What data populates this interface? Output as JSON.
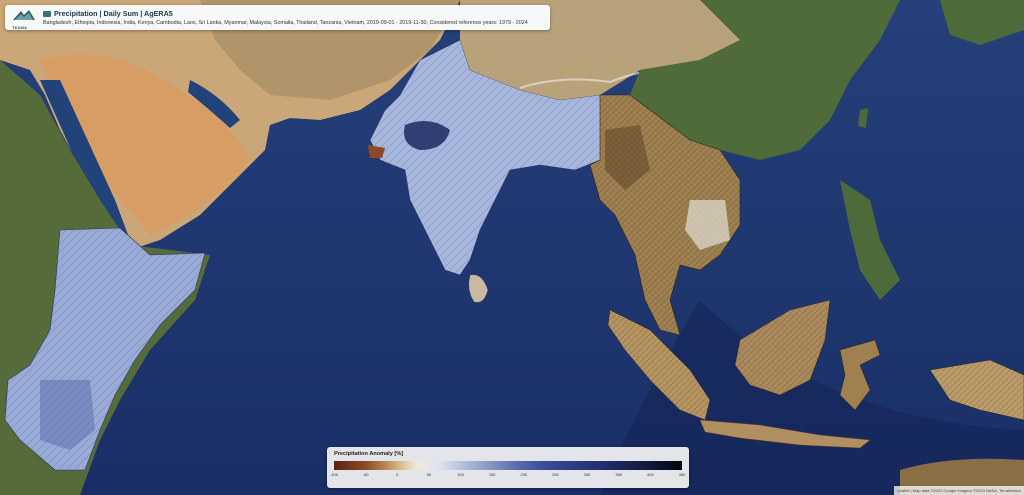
{
  "header": {
    "title": "Precipitation | Daily Sum | AgERA5",
    "subtitle": "Bangladesh, Ethiopia, Indonesia, India, Kenya, Cambodia, Laos, Sri Lanka, Myanmar, Malaysia, Somalia, Thailand, Tanzania, Vietnam, 2019-09-01 - 2019-11-30, Considered reference years: 1979 - 2024",
    "logo_text": "TEAMA"
  },
  "legend": {
    "title": "Precipitation Anomaly [%]",
    "ticks": [
      "-100",
      "-50",
      "0",
      "50",
      "100",
      "150",
      "200",
      "250",
      "300",
      "350",
      "400",
      "450"
    ]
  },
  "attribution": "Leaflet | Map data ©2023 Google Imagery ©2023 NASA, TerraMetrics",
  "colors": {
    "ocean": "#1e3570",
    "wet_region": "#8e9fcf",
    "dry_region": "#8a6b3c",
    "land": "#b89a68"
  }
}
